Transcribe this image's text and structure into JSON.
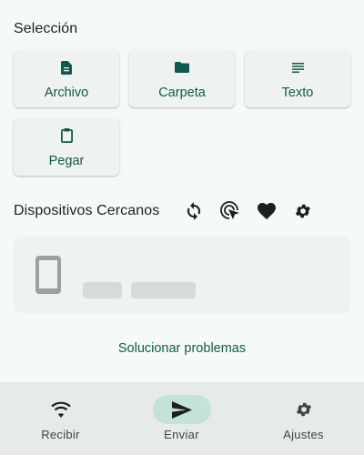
{
  "selection": {
    "title": "Selección",
    "items": [
      {
        "label": "Archivo",
        "icon": "file-icon"
      },
      {
        "label": "Carpeta",
        "icon": "folder-icon"
      },
      {
        "label": "Texto",
        "icon": "text-icon"
      },
      {
        "label": "Pegar",
        "icon": "clipboard-icon"
      }
    ]
  },
  "nearby": {
    "title": "Dispositivos Cercanos",
    "tools": [
      "refresh-icon",
      "target-cursor-icon",
      "heart-icon",
      "gear-icon"
    ]
  },
  "troubleshoot": {
    "label": "Solucionar problemas"
  },
  "nav": {
    "items": [
      {
        "label": "Recibir",
        "icon": "wifi-icon"
      },
      {
        "label": "Enviar",
        "icon": "send-icon",
        "active": true
      },
      {
        "label": "Ajustes",
        "icon": "gear-icon"
      }
    ]
  },
  "colors": {
    "accent": "#0f5a4c",
    "active_pill": "#c3e3da",
    "background": "#f5f9f7"
  }
}
